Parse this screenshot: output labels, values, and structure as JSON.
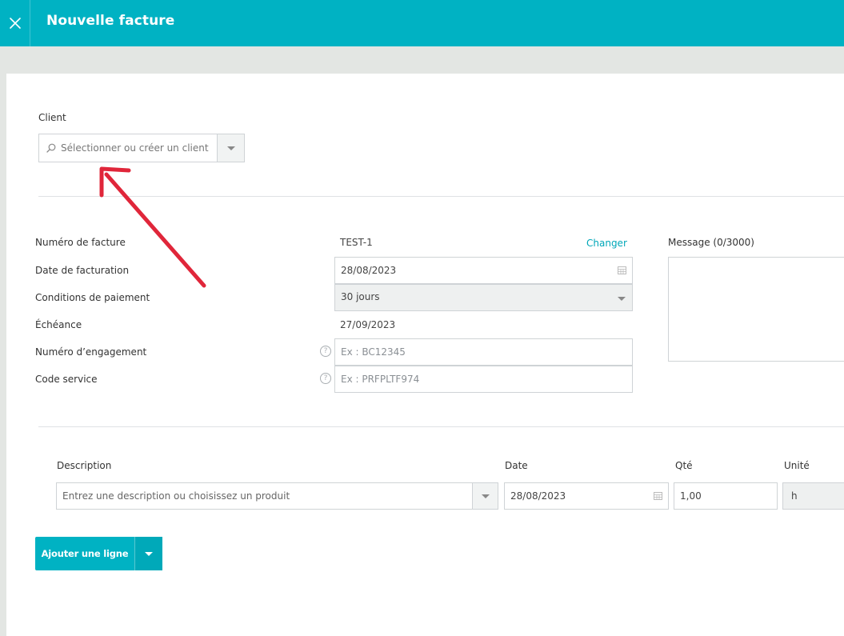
{
  "header": {
    "title": "Nouvelle facture"
  },
  "client": {
    "label": "Client",
    "placeholder": "Sélectionner ou créer un client"
  },
  "invoice": {
    "number_label": "Numéro de facture",
    "number_value": "TEST-1",
    "change_link": "Changer",
    "date_label": "Date de facturation",
    "date_value": "28/08/2023",
    "terms_label": "Conditions de paiement",
    "terms_value": "30 jours",
    "due_label": "Échéance",
    "due_value": "27/09/2023",
    "engagement_label": "Numéro d’engagement",
    "engagement_placeholder": "Ex : BC12345",
    "service_label": "Code service",
    "service_placeholder": "Ex : PRFPLTF974",
    "message_label": "Message (0/3000)"
  },
  "lines": {
    "headers": {
      "description": "Description",
      "date": "Date",
      "qty": "Qté",
      "unit": "Unité"
    },
    "row": {
      "description_placeholder": "Entrez une description ou choisissez un produit",
      "date": "28/08/2023",
      "qty": "1,00",
      "unit": "h"
    }
  },
  "actions": {
    "add_line": "Ajouter une ligne"
  },
  "colors": {
    "accent": "#00b2c3",
    "annotation_arrow": "#e0263a"
  },
  "icons": [
    "close-icon",
    "search-icon",
    "chevron-down-icon",
    "calendar-icon",
    "help-icon",
    "annotation-arrow"
  ]
}
